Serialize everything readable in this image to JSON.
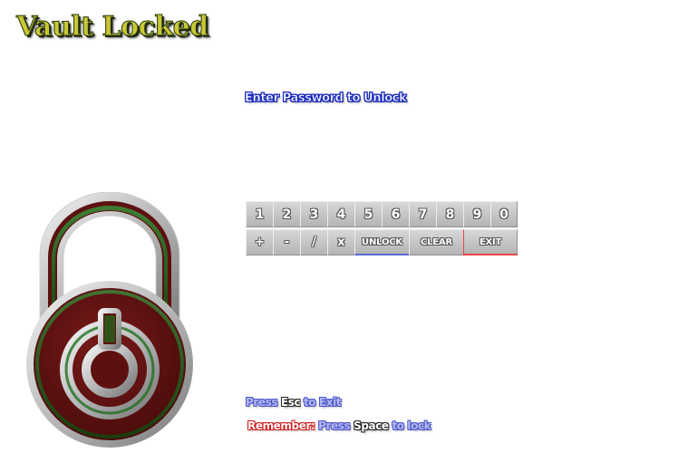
{
  "app": {
    "title": "Vault Locked"
  },
  "prompt": {
    "text": "Enter Password to Unlock"
  },
  "keypad": {
    "digits": [
      "1",
      "2",
      "3",
      "4",
      "5",
      "6",
      "7",
      "8",
      "9",
      "0"
    ],
    "operators": [
      "+",
      "-",
      "/",
      "x"
    ],
    "unlock_label": "UNLOCK",
    "clear_label": "CLEAR",
    "exit_label": "EXIT"
  },
  "hints": {
    "exit": {
      "press": "Press",
      "key": "Esc",
      "action": "to Exit"
    },
    "lock": {
      "remember": "Remember:",
      "press": "Press",
      "key": "Space",
      "action": "to lock"
    }
  },
  "colors": {
    "lock_body": "#6b1414",
    "lock_ring": "#1f6f1f",
    "lock_metal": "#b8b8b8",
    "title_fill": "#c8c834",
    "prompt_outline": "#1c2cc8",
    "exit_accent": "#e84848",
    "unlock_accent": "#5a6ad6"
  },
  "icons": {
    "lock": "padlock-icon",
    "power": "power-icon"
  }
}
